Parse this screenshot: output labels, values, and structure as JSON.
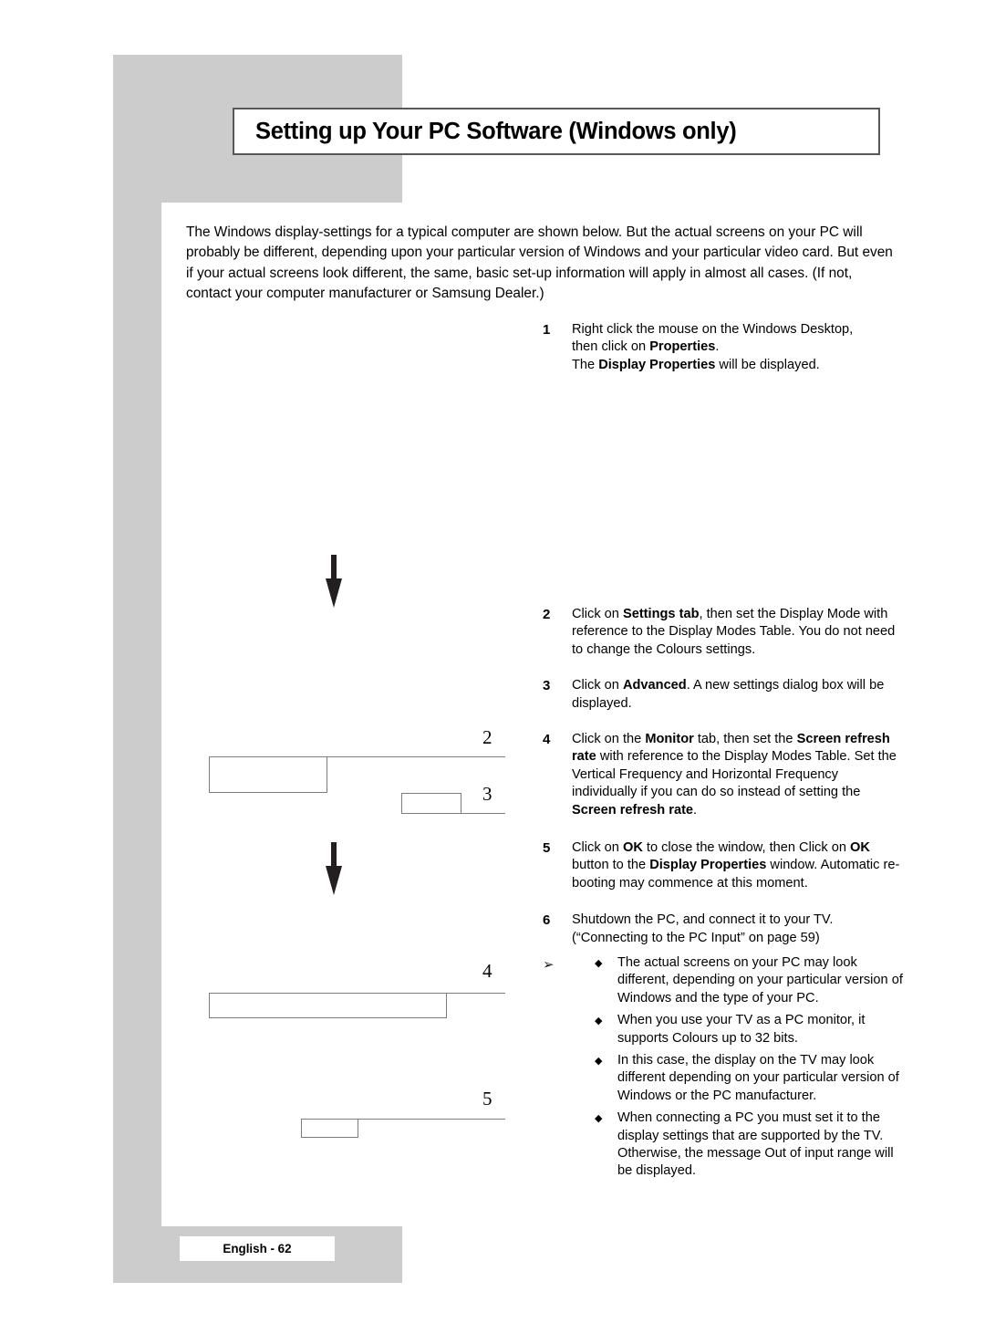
{
  "page": {
    "title": "Setting up Your PC Software (Windows only)",
    "footer_label": "English - 62",
    "intro": "The Windows display-settings for a typical computer are shown below. But the actual screens on your PC will probably be different, depending upon your particular version of Windows and your particular video card. But even if your actual screens look different, the same, basic set-up information will apply in almost all cases. (If not, contact your computer manufacturer or Samsung Dealer.)"
  },
  "steps": [
    {
      "number": "1",
      "lines": [
        {
          "text": "Right click the mouse on the Windows Desktop,"
        },
        {
          "text": "then click on "
        },
        {
          "text": "Properties",
          "bold": true
        },
        {
          "text": "."
        },
        {
          "text": "The "
        },
        {
          "text": "Display Properties",
          "bold": true
        },
        {
          "text": " will be displayed."
        }
      ],
      "plain": "Right click the mouse on the Windows Desktop, then click on Properties. The Display Properties will be displayed."
    },
    {
      "number": "2",
      "plain": "Click on Settings tab, then set the Display Mode with reference to the Display Modes Table. You do not need to change the Colours settings."
    },
    {
      "number": "3",
      "plain": "Click on Advanced. A new settings dialog box will be displayed."
    },
    {
      "number": "4",
      "plain": "Click on the Monitor tab, then set the Screen refresh rate with reference to the Display Modes Table. Set the Vertical Frequency and Horizontal Frequency individually if you can do so instead of setting the Screen refresh rate."
    },
    {
      "number": "5",
      "plain": "Click on OK to close the window, then Click on OK button to the Display Properties window. Automatic re-booting may commence at this moment."
    },
    {
      "number": "6",
      "plain": "Shutdown the PC, and connect it to your TV. (“Connecting to the PC Input” on page 59)"
    }
  ],
  "notes": {
    "arrow_glyph": "➢",
    "bullet_glyph": "◆",
    "items": [
      "The actual screens on your PC may look different, depending on your particular version of Windows and the type of your PC.",
      "When you use your TV as a PC monitor, it supports Colours up to 32 bits.",
      "In this case, the display on the TV may look different depending on your particular version of Windows or the PC manufacturer.",
      "When connecting a PC you must set it to the display settings that are supported by the TV. Otherwise, the message Out of input range      will be displayed."
    ]
  },
  "callouts": [
    {
      "number": "2"
    },
    {
      "number": "3"
    },
    {
      "number": "4"
    },
    {
      "number": "5"
    }
  ],
  "colors": {
    "gray_block": "#cccccc",
    "title_border": "#58585a",
    "callout_stroke": "#7c7c7c",
    "text": "#000000"
  }
}
